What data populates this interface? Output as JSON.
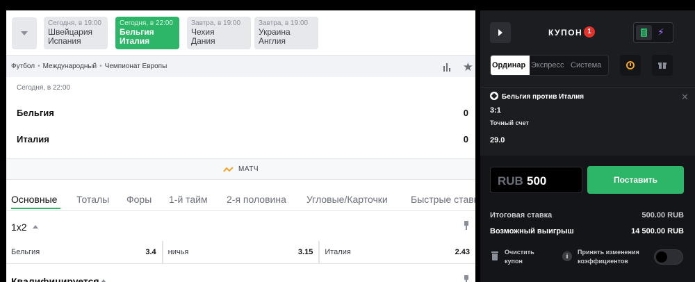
{
  "match_switch": {
    "matches": [
      {
        "time": "Сегодня, в 19:00",
        "team1": "Швейцария",
        "team2": "Испания",
        "active": false
      },
      {
        "time": "Сегодня, в 22:00",
        "team1": "Бельгия",
        "team2": "Италия",
        "active": true
      },
      {
        "time": "Завтра, в 19:00",
        "team1": "Чехия",
        "team2": "Дания",
        "active": false
      },
      {
        "time": "Завтра, в 19:00",
        "team1": "Украина",
        "team2": "Англия",
        "active": false
      }
    ]
  },
  "breadcrumb": [
    "Футбол",
    "Международный",
    "Чемпионат Европы"
  ],
  "scoreboard": {
    "date": "Сегодня, в 22:00",
    "team1": "Бельгия",
    "team2": "Италия",
    "score1": "0",
    "score2": "0"
  },
  "match_label": "МАТЧ",
  "tabs": [
    "Основные",
    "Тоталы",
    "Форы",
    "1-й тайм",
    "2-я половина",
    "Угловые/Карточки",
    "Быстрые ставки"
  ],
  "market": {
    "title": "1x2",
    "odds": [
      {
        "label": "Бельгия",
        "value": "3.4"
      },
      {
        "label": "ничья",
        "value": "3.15"
      },
      {
        "label": "Италия",
        "value": "2.43"
      }
    ]
  },
  "market2": {
    "title": "Квалифицируется"
  },
  "coupon": {
    "title": "КУПОН",
    "count": "1",
    "bet_types": [
      "Ординар",
      "Экспресс",
      "Система"
    ],
    "event": "Бельгия против Италия",
    "outcome": "3:1",
    "market": "Точный счет",
    "odds": "29.0",
    "stake_currency": "RUB",
    "stake_value": "500",
    "place_label": "Поставить",
    "total_label": "Итоговая ставка",
    "total_value": "500.00 RUB",
    "win_label": "Возможный выигрыш",
    "win_value": "14 500.00 RUB",
    "clear_label": "Очистить купон",
    "accept_label": "Принять изменения коэффициентов"
  },
  "colors": {
    "accent": "#2db667",
    "badge": "#e4322b",
    "panel": "#1c1d21"
  }
}
